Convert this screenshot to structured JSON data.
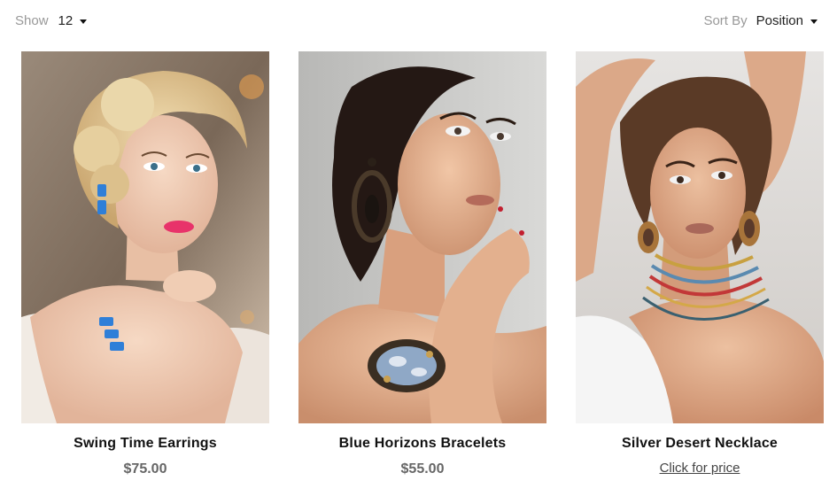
{
  "toolbar": {
    "show_label": "Show",
    "show_value": "12",
    "sort_label": "Sort By",
    "sort_value": "Position"
  },
  "products": [
    {
      "name": "Swing Time Earrings",
      "price": "$75.00",
      "image_icon": "model-earrings-photo"
    },
    {
      "name": "Blue Horizons Bracelets",
      "price": "$55.00",
      "image_icon": "model-bracelet-photo"
    },
    {
      "name": "Silver Desert Necklace",
      "price_link": "Click for price",
      "image_icon": "model-necklace-photo"
    }
  ],
  "colors": {
    "label_gray": "#999999",
    "price_gray": "#666666",
    "title_black": "#111111"
  }
}
